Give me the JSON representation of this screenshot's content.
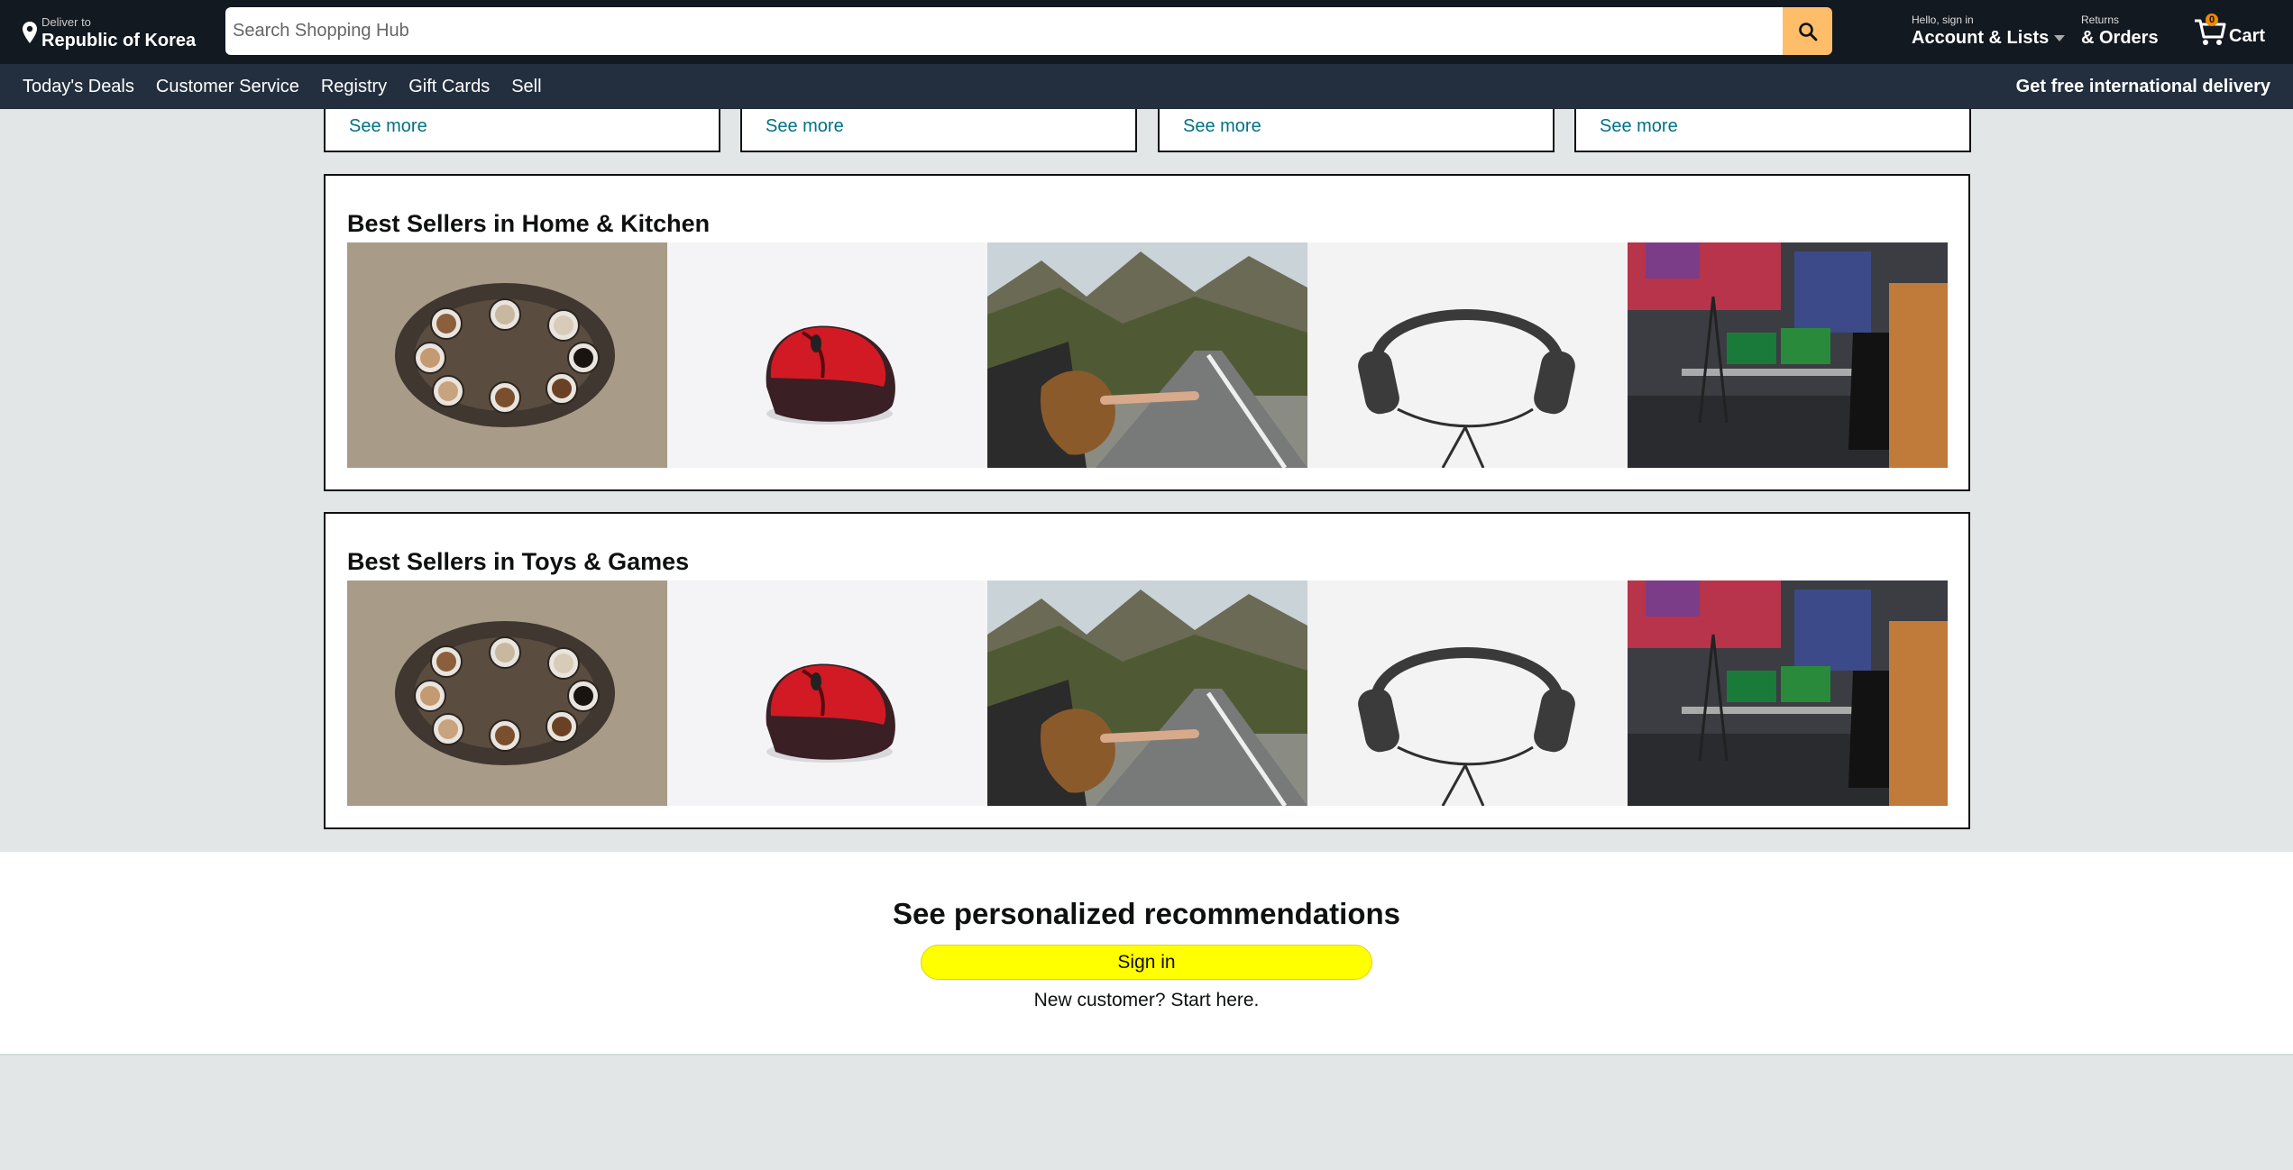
{
  "header": {
    "deliver_small": "Deliver to",
    "deliver_location": "Republic of Korea",
    "search_placeholder": "Search Shopping Hub",
    "account_small": "Hello, sign in",
    "account_big": "Account & Lists",
    "returns_small": "Returns",
    "returns_big": "& Orders",
    "cart_count": "0",
    "cart_label": "Cart"
  },
  "subnav": {
    "items": [
      "Today's Deals",
      "Customer Service",
      "Registry",
      "Gift Cards",
      "Sell"
    ],
    "right": "Get free international delivery"
  },
  "top_cards": [
    {
      "link": "See more"
    },
    {
      "link": "See more"
    },
    {
      "link": "See more"
    },
    {
      "link": "See more"
    }
  ],
  "sections": [
    {
      "title": "Best Sellers in Home & Kitchen",
      "images": [
        "coffee-cups-photo",
        "red-mouse-photo",
        "road-trip-photo",
        "headphones-photo",
        "gaming-room-photo"
      ]
    },
    {
      "title": "Best Sellers in Toys & Games",
      "images": [
        "coffee-cups-photo",
        "red-mouse-photo",
        "road-trip-photo",
        "headphones-photo",
        "gaming-room-photo"
      ]
    }
  ],
  "signin": {
    "heading": "See personalized recommendations",
    "button": "Sign in",
    "new_customer": "New customer? Start here."
  },
  "colors": {
    "topbar": "#131921",
    "subnav": "#232f3e",
    "search_button": "#febd69",
    "signin_button": "#ffff00",
    "link": "#007185"
  }
}
